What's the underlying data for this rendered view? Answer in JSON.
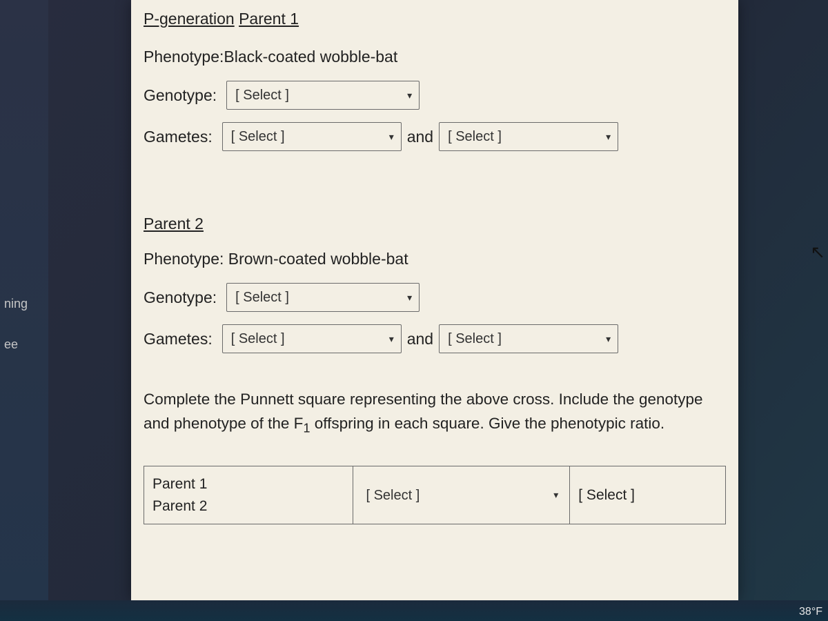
{
  "sidebar": {
    "items": [
      "ning",
      "ee"
    ]
  },
  "content": {
    "section_title": "P-generation",
    "parent1": {
      "heading": "Parent 1",
      "phenotype_label": "Phenotype:",
      "phenotype_value": "Black-coated wobble-bat",
      "genotype_label": "Genotype:",
      "genotype_select": "[ Select ]",
      "gametes_label": "Gametes:",
      "gamete_select_1": "[ Select ]",
      "and_label": "and",
      "gamete_select_2": "[ Select ]"
    },
    "parent2": {
      "heading": "Parent 2",
      "phenotype_label": "Phenotype:",
      "phenotype_value": " Brown-coated wobble-bat",
      "genotype_label": "Genotype:",
      "genotype_select": "[ Select ]",
      "gametes_label": "Gametes:",
      "gamete_select_1": "[ Select ]",
      "and_label": "and",
      "gamete_select_2": "[ Select ]"
    },
    "instructions_pre": "Complete the Punnett square representing the above cross.  Include the genotype and phenotype of the F",
    "instructions_sub": "1",
    "instructions_post": " offspring in each square.  Give the phenotypic ratio.",
    "table": {
      "r1c1a": "Parent 1",
      "r1c1b": "Parent 2",
      "r1c2_select": "[ Select ]",
      "r1c3_select": "[ Select ]"
    }
  },
  "system": {
    "temperature": "38°F"
  }
}
